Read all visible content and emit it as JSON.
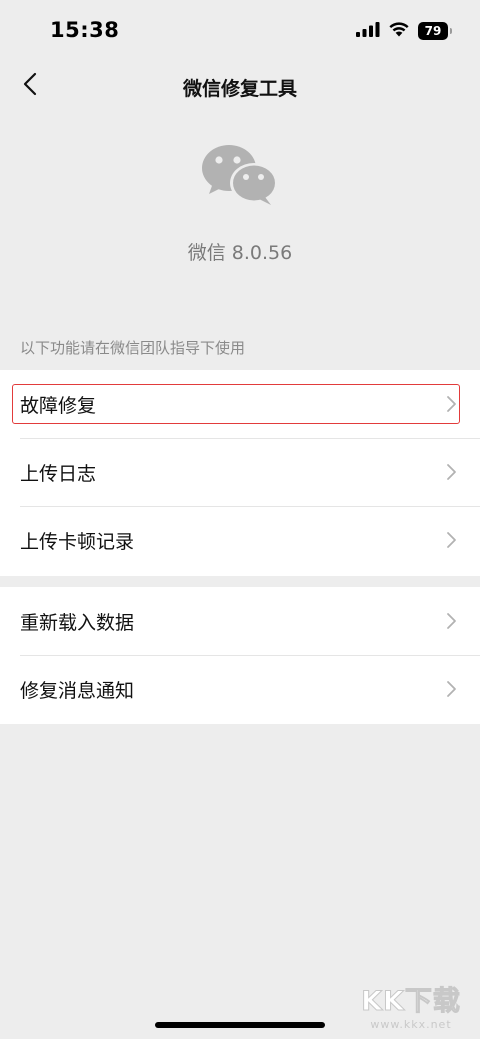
{
  "status_bar": {
    "time": "15:38",
    "battery": "79",
    "icons": [
      "signal-icon",
      "wifi-icon",
      "battery-icon"
    ]
  },
  "nav": {
    "back_icon": "chevron-left-icon",
    "title": "微信修复工具"
  },
  "app": {
    "logo_icon": "wechat-logo-icon",
    "version": "微信 8.0.56"
  },
  "section_caption": "以下功能请在微信团队指导下使用",
  "groups": [
    {
      "items": [
        {
          "label": "故障修复",
          "highlighted": true
        },
        {
          "label": "上传日志"
        },
        {
          "label": "上传卡顿记录"
        }
      ]
    },
    {
      "items": [
        {
          "label": "重新载入数据"
        },
        {
          "label": "修复消息通知"
        }
      ]
    }
  ],
  "watermark": {
    "logo_text": "KK下载",
    "url": "www.kkx.net"
  },
  "colors": {
    "background": "#ededed",
    "card": "#ffffff",
    "highlight_border": "#e23b3b",
    "caption_text": "#8a8a8a",
    "icon_gray": "#b2b2b2"
  }
}
